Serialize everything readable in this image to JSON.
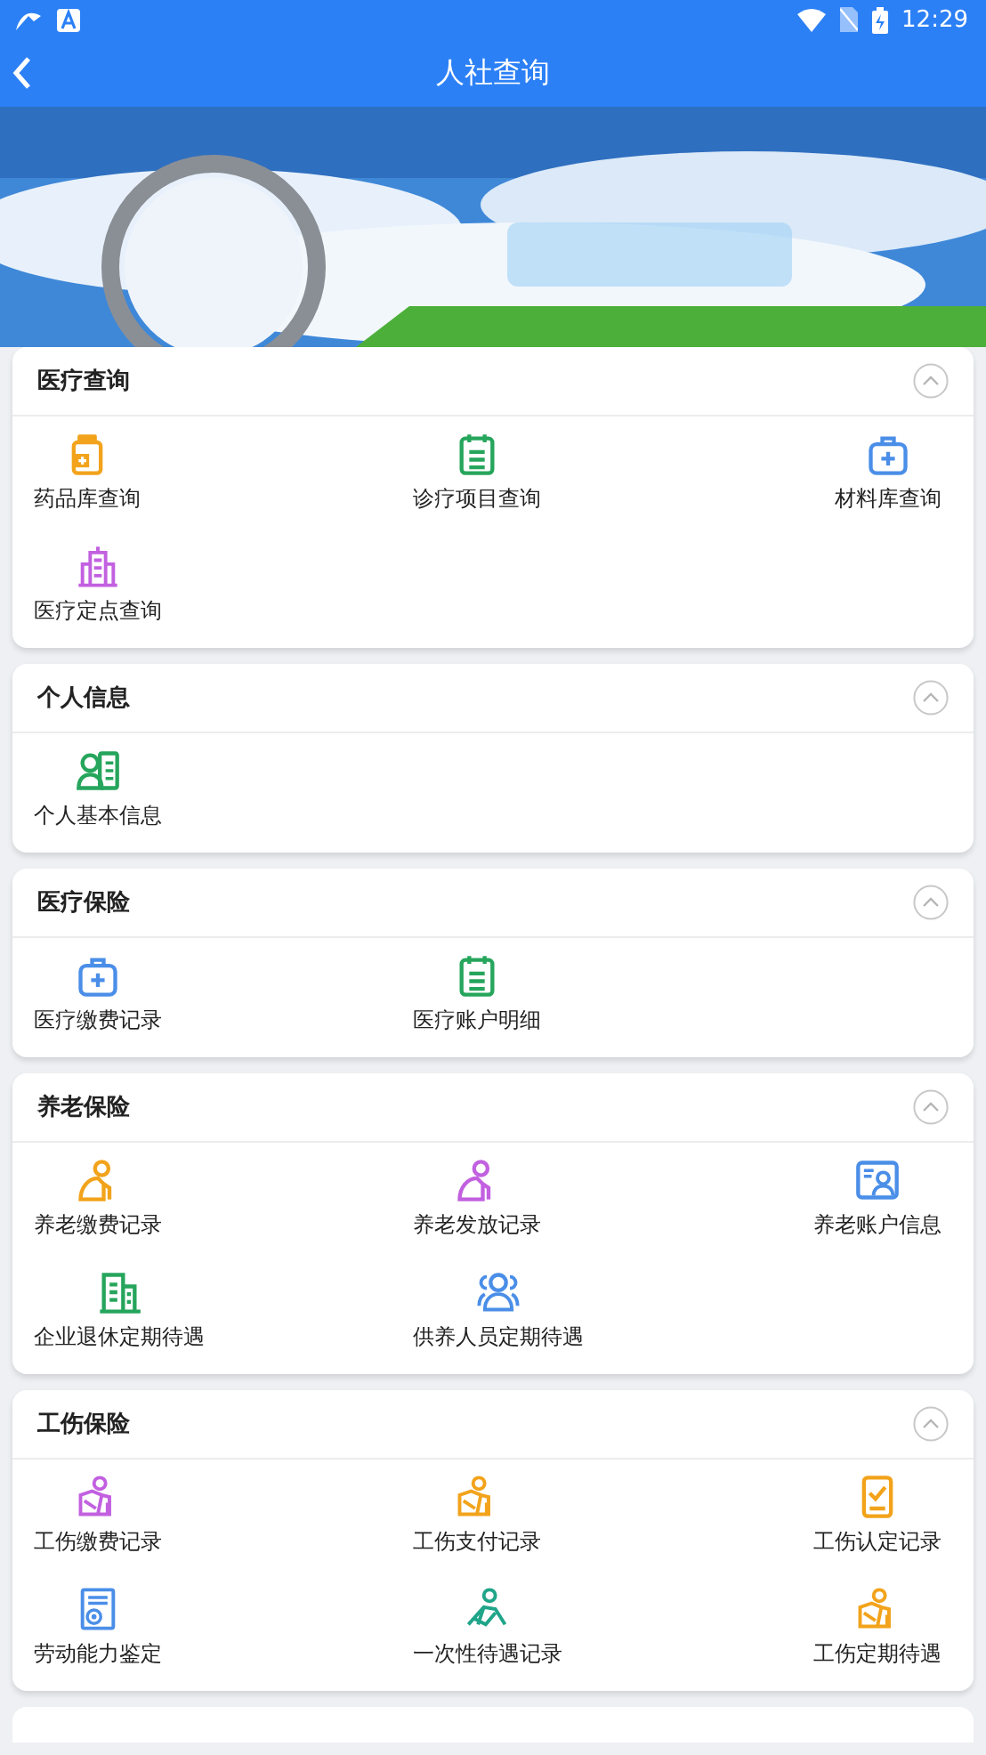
{
  "status_bar": {
    "time": "12:29"
  },
  "header": {
    "title": "人社查询"
  },
  "sections": [
    {
      "title": "医疗查询",
      "expanded": true,
      "items": [
        {
          "label": "药品库查询"
        },
        {
          "label": "诊疗项目查询"
        },
        {
          "label": "材料库查询"
        },
        {
          "label": "医疗定点查询"
        }
      ]
    },
    {
      "title": "个人信息",
      "expanded": true,
      "items": [
        {
          "label": "个人基本信息"
        }
      ]
    },
    {
      "title": "医疗保险",
      "expanded": true,
      "items": [
        {
          "label": "医疗缴费记录"
        },
        {
          "label": "医疗账户明细"
        }
      ]
    },
    {
      "title": "养老保险",
      "expanded": true,
      "items": [
        {
          "label": "养老缴费记录"
        },
        {
          "label": "养老发放记录"
        },
        {
          "label": "养老账户信息"
        },
        {
          "label": "企业退休定期待遇"
        },
        {
          "label": "供养人员定期待遇"
        }
      ]
    },
    {
      "title": "工伤保险",
      "expanded": true,
      "items": [
        {
          "label": "工伤缴费记录"
        },
        {
          "label": "工伤支付记录"
        },
        {
          "label": "工伤认定记录"
        },
        {
          "label": "劳动能力鉴定"
        },
        {
          "label": "一次性待遇记录"
        },
        {
          "label": "工伤定期待遇"
        }
      ]
    }
  ]
}
